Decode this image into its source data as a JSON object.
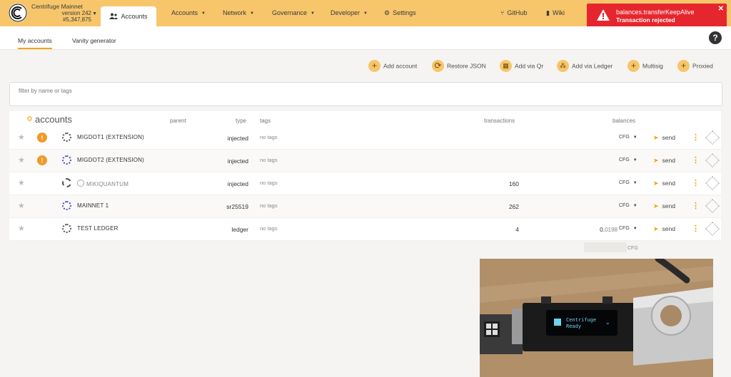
{
  "app": {
    "chain_name": "Centrifuge Mainnet",
    "version": "version 242",
    "block": "#5,347,875"
  },
  "nav": {
    "active_tab": "Accounts",
    "items": [
      {
        "label": "Accounts"
      },
      {
        "label": "Network"
      },
      {
        "label": "Governance"
      },
      {
        "label": "Developer"
      },
      {
        "label": "Settings"
      }
    ],
    "right": [
      {
        "label": "GitHub"
      },
      {
        "label": "Wiki"
      }
    ]
  },
  "notification": {
    "method": "balances.transferKeepAlive",
    "status": "Transaction rejected",
    "color": "#e6262e"
  },
  "subtabs": [
    {
      "label": "My accounts",
      "active": true
    },
    {
      "label": "Vanity generator",
      "active": false
    }
  ],
  "actions": [
    {
      "label": "Add account",
      "icon": "plus-icon"
    },
    {
      "label": "Restore JSON",
      "icon": "sync-icon"
    },
    {
      "label": "Add via Qr",
      "icon": "qrcode-icon"
    },
    {
      "label": "Add via Ledger",
      "icon": "ledger-icon"
    },
    {
      "label": "Multisig",
      "icon": "plus-icon"
    },
    {
      "label": "Proxied",
      "icon": "plus-icon"
    }
  ],
  "filter": {
    "label": "filter by name or tags"
  },
  "table": {
    "title": "accounts",
    "headers": {
      "parent": "parent",
      "type": "type",
      "tags": "tags",
      "transactions": "transactions",
      "balances": "balances"
    },
    "rows": [
      {
        "name": "MIGDOT1 (EXTENSION)",
        "type": "injected",
        "tags": "no tags",
        "transactions": "",
        "balance_int": "",
        "balance_dec": "",
        "currency": "CFG",
        "send": "send",
        "warning": true
      },
      {
        "name": "MIGDOT2 (EXTENSION)",
        "type": "injected",
        "tags": "no tags",
        "transactions": "",
        "balance_int": "",
        "balance_dec": "",
        "currency": "CFG",
        "send": "send",
        "warning": true
      },
      {
        "name": "MIKIQUANTUM",
        "type": "injected",
        "tags": "no tags",
        "transactions": "160",
        "balance_int": "",
        "balance_dec": "",
        "currency": "CFG",
        "send": "send",
        "warning": false
      },
      {
        "name": "MAINNET 1",
        "type": "sr25519",
        "tags": "no tags",
        "transactions": "262",
        "balance_int": "",
        "balance_dec": "",
        "currency": "CFG",
        "send": "send",
        "warning": false
      },
      {
        "name": "TEST LEDGER",
        "type": "ledger",
        "tags": "no tags",
        "transactions": "4",
        "balance_int": "0.",
        "balance_dec": "0198",
        "currency": "CFG",
        "send": "send",
        "warning": false
      }
    ],
    "total_currency": "CFG"
  },
  "device": {
    "line1": "Centrifuge",
    "line2": "Ready"
  },
  "colors": {
    "topbar": "#f7c66b",
    "accent": "#f7a500"
  }
}
